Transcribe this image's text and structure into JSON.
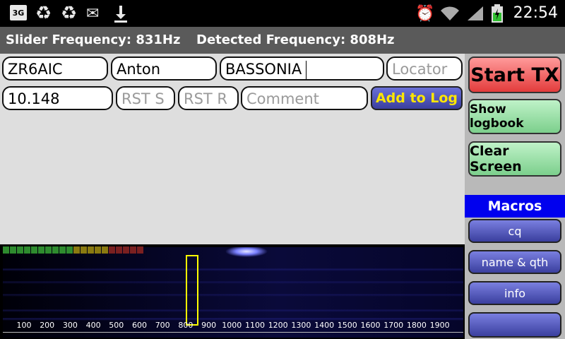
{
  "status_bar": {
    "network_badge": "3G",
    "left_icons": [
      "recycle-icon",
      "recycle-icon",
      "email-icon",
      "download-icon"
    ],
    "right_icons": [
      "alarm-icon",
      "wifi-icon",
      "signal-icon",
      "battery-charging-icon"
    ],
    "time": "22:54"
  },
  "frequency": {
    "slider_label": "Slider Frequency: 831Hz",
    "detected_label": "Detected Frequency: 808Hz"
  },
  "form": {
    "callsign": "ZR6AIC",
    "name": "Anton",
    "qth": "BASSONIA",
    "locator_placeholder": "Locator",
    "frequency": "10.148",
    "rst_sent_placeholder": "RST S",
    "rst_received_placeholder": "RST R",
    "comment_placeholder": "Comment",
    "add_to_log": "Add to Log"
  },
  "right_panel": {
    "start_tx": "Start TX",
    "show_logbook": "Show logbook",
    "clear_screen": "Clear Screen",
    "macros_header": "Macros",
    "macros": [
      "cq",
      "name & qth",
      "info",
      ""
    ]
  },
  "waterfall": {
    "scale_labels": [
      "100",
      "200",
      "300",
      "400",
      "500",
      "600",
      "700",
      "800",
      "900",
      "1000",
      "1100",
      "1200",
      "1300",
      "1400",
      "1500",
      "1600",
      "1700",
      "1800",
      "1900"
    ],
    "signal_meter_colors": [
      "#2e8b2e",
      "#2e8b2e",
      "#2e8b2e",
      "#2e8b2e",
      "#2e8b2e",
      "#2e8b2e",
      "#2e8b2e",
      "#2e8b2e",
      "#2e8b2e",
      "#2e8b2e",
      "#8a7a10",
      "#8a7a10",
      "#8a7a10",
      "#8a7a10",
      "#8a7a10",
      "#7a2020",
      "#7a2020",
      "#7a2020",
      "#7a2020",
      "#7a2020"
    ]
  }
}
